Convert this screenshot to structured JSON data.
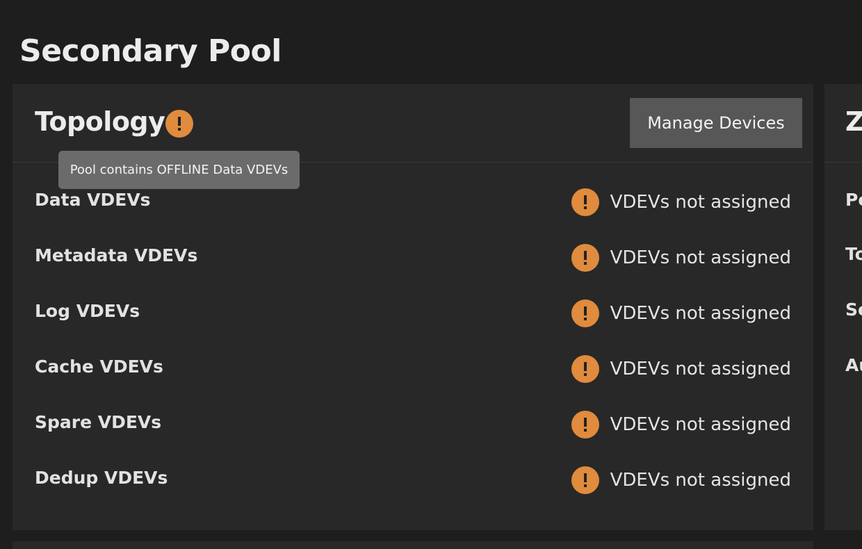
{
  "page": {
    "title": "Secondary Pool"
  },
  "topology": {
    "title": "Topology",
    "manage_label": "Manage Devices",
    "tooltip": "Pool contains OFFLINE Data VDEVs",
    "rows": [
      {
        "label": "Data VDEVs",
        "status": "VDEVs not assigned"
      },
      {
        "label": "Metadata VDEVs",
        "status": "VDEVs not assigned"
      },
      {
        "label": "Log VDEVs",
        "status": "VDEVs not assigned"
      },
      {
        "label": "Cache VDEVs",
        "status": "VDEVs not assigned"
      },
      {
        "label": "Spare VDEVs",
        "status": "VDEVs not assigned"
      },
      {
        "label": "Dedup VDEVs",
        "status": "VDEVs not assigned"
      }
    ]
  },
  "side_card": {
    "title": "Z",
    "rows": [
      "Po",
      "To",
      "Se",
      "Au"
    ]
  },
  "colors": {
    "background": "#1e1e1e",
    "card": "#282828",
    "warning": "#e08b3d",
    "button": "#575757",
    "tooltip": "#6b6b6b"
  },
  "icons": {
    "warning": "alert-circle-icon"
  }
}
